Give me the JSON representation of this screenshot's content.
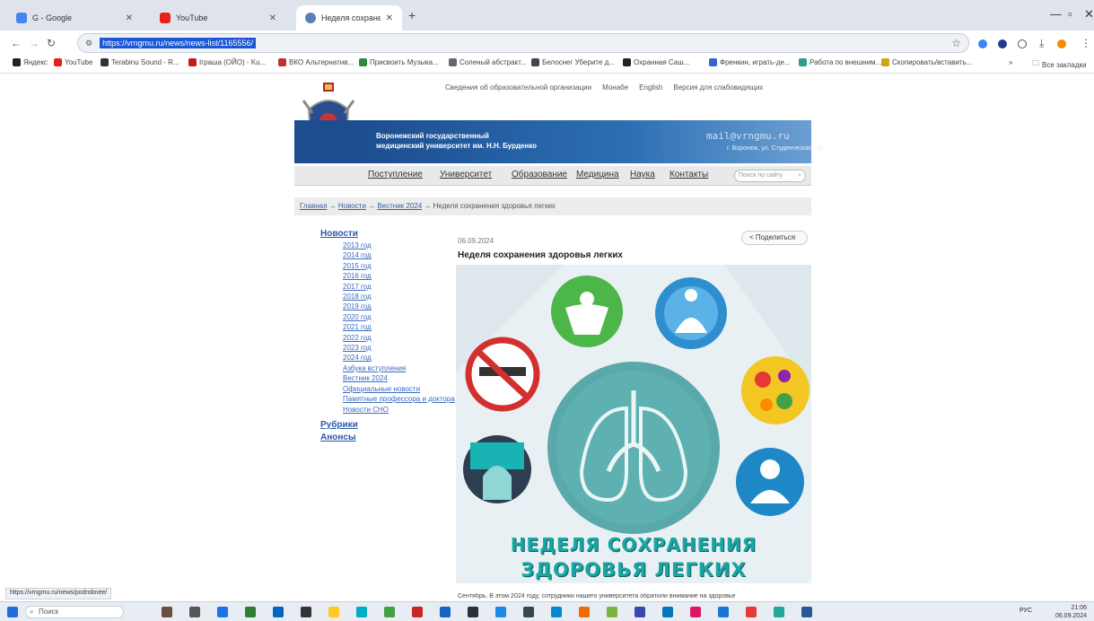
{
  "browser": {
    "tabs": [
      {
        "label": "G - Google",
        "color": "#4285f4",
        "active": false
      },
      {
        "label": "YouTube",
        "color": "#e62117",
        "active": false
      },
      {
        "label": "Неделя сохранения здоровья ...",
        "color": "#5a7fb6",
        "active": true
      }
    ],
    "url": "https://vrngmu.ru/news/news-list/1165556/",
    "bookmarks": [
      {
        "label": "Яндекс",
        "color": "#222"
      },
      {
        "label": "YouTube",
        "color": "#e62117"
      },
      {
        "label": "Terabinu Sound - R...",
        "color": "#333"
      },
      {
        "label": "Іграша (ОЙО) - Ku...",
        "color": "#c41a1a"
      },
      {
        "label": "ВКО Альтернатив...",
        "color": "#b33"
      },
      {
        "label": "Присвоить Музыка...",
        "color": "#2b8a3e"
      },
      {
        "label": "Соленый абстракт...",
        "color": "#667"
      },
      {
        "label": "Белоснег Уберите д...",
        "color": "#445"
      },
      {
        "label": "Охранная Саш...",
        "color": "#222"
      },
      {
        "label": "Френкин, играть-де...",
        "color": "#3366cc"
      },
      {
        "label": "Работа по внешним...",
        "color": "#2a9d8f"
      },
      {
        "label": "Скопировать/вставить...",
        "color": "#d4a017"
      }
    ],
    "bookmarks_all": "Все закладки",
    "status_url": "https://vrngmu.ru/news/podrobnee/"
  },
  "site": {
    "toplinks": [
      "Сведения об образовательной организации",
      "Монабе",
      "English",
      "Версия для слабовидящих"
    ],
    "name_line1": "Воронежский государственный",
    "name_line2": "медицинский университет им. Н.Н. Бурденко",
    "email": "mail@vrngmu.ru",
    "address": "г. Воронеж, ул. Студенческая, 10",
    "menu": [
      "Поступление",
      "Университет",
      "Образование",
      "Медицина",
      "Наука",
      "Контакты"
    ],
    "search_placeholder": "Поиск по сайту",
    "breadcrumbs": [
      "Главная",
      "Новости",
      "Вестник 2024"
    ],
    "breadcrumb_current": "Неделя сохранения здоровья легких"
  },
  "leftnav": {
    "news": "Новости",
    "years": [
      "2013 год",
      "2014 год",
      "2015 год",
      "2016 год",
      "2017 год",
      "2018 год",
      "2019 год",
      "2020 год",
      "2021 год",
      "2022 год",
      "2023 год",
      "2024 год"
    ],
    "extras": [
      "Азбука вступления",
      "Вестник 2024",
      "Официальные новости",
      "Памятные профессора и доктора",
      "Новости СНО"
    ],
    "rubrics": "Рубрики",
    "announcements": "Анонсы"
  },
  "article": {
    "date": "06.09.2024",
    "share": "Поделиться",
    "title": "Неделя сохранения здоровья легких",
    "poster_line1": "НЕДЕЛЯ СОХРАНЕНИЯ",
    "poster_line2": "ЗДОРОВЬЯ ЛЕГКИХ",
    "body_start": "Сентябрь. В этом 2024 году, сотрудники нашего университета обратили внимание на здоровье"
  },
  "taskbar": {
    "search": "Поиск",
    "time": "21:06",
    "date": "06.09.2024",
    "lang": "РУС"
  }
}
